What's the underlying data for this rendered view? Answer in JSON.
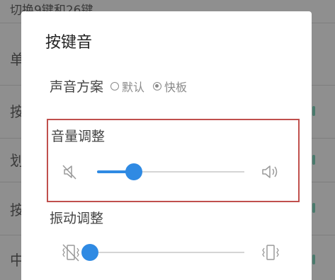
{
  "background_list": {
    "rows": [
      {
        "label": "切换9键和26键"
      },
      {
        "label": "单"
      },
      {
        "label": "按"
      },
      {
        "label": "划"
      },
      {
        "label": "按"
      },
      {
        "label": "中"
      }
    ]
  },
  "dialog": {
    "title": "按键音",
    "sound_scheme": {
      "label": "声音方案",
      "options": [
        {
          "label": "默认",
          "selected": false
        },
        {
          "label": "快板",
          "selected": true
        }
      ]
    },
    "volume": {
      "title": "音量调整",
      "level": 0.25,
      "min_icon": "volume-mute-icon",
      "max_icon": "volume-up-icon"
    },
    "vibration": {
      "title": "振动调整",
      "level": 0.0,
      "min_icon": "vibration-off-icon",
      "max_icon": "vibration-icon"
    }
  },
  "colors": {
    "accent": "#2f8ae3",
    "highlight_border": "#c0504d"
  }
}
